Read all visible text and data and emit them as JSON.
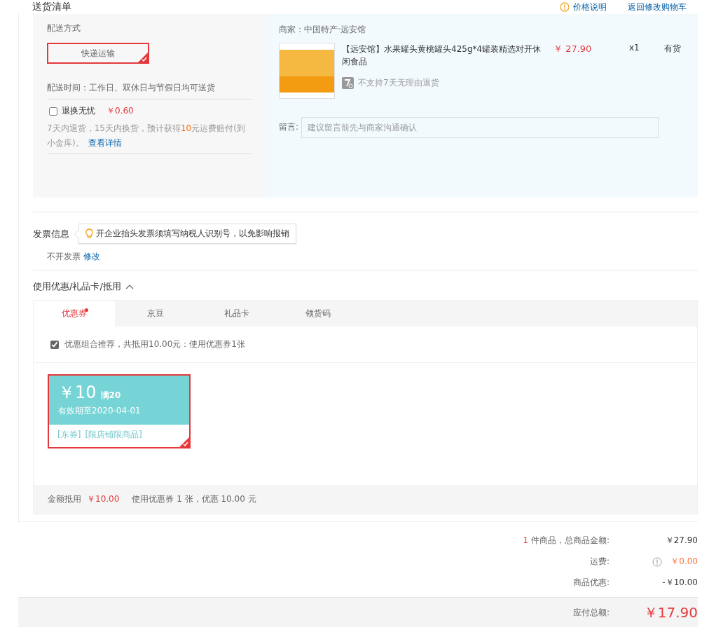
{
  "header": {
    "title": "送货清单",
    "price_note": "价格说明",
    "back_link": "返回修改购物车"
  },
  "shipping": {
    "label": "配送方式",
    "options": [
      {
        "label": "快递运输",
        "selected": true
      }
    ],
    "delivery_time": "配送时间：工作日、双休日与节假日均可送货",
    "insurance": {
      "label": "退换无忧",
      "checked": false,
      "price": "￥0.60",
      "text_before": "7天内退货，15天内换货，预计获得",
      "highlight": "10",
      "text_after": "元运费赔付(到小金库)。",
      "link": "查看详情"
    }
  },
  "seller": {
    "name": "商家：中国特产·远安馆",
    "items": [
      {
        "title": "【远安馆】水果罐头黄桃罐头425g*4罐装精选对开休闲食品",
        "price": "￥ 27.90",
        "quantity": "x1",
        "stock": "有货",
        "return_policy": "不支持7天无理由退货"
      }
    ],
    "message": {
      "label": "留言:",
      "placeholder": "建议留言前先与商家沟通确认"
    }
  },
  "invoice": {
    "title": "发票信息",
    "tip": "开企业抬头发票须填写纳税人识别号，以免影响报销",
    "value": "不开发票",
    "edit_link": "修改"
  },
  "discounts": {
    "title": "使用优惠/礼品卡/抵用",
    "expanded": true,
    "tabs": [
      {
        "label": "优惠券",
        "selected": true,
        "dot": true
      },
      {
        "label": "京豆",
        "selected": false,
        "dot": false
      },
      {
        "label": "礼品卡",
        "selected": false,
        "dot": false
      },
      {
        "label": "领货码",
        "selected": false,
        "dot": false
      }
    ],
    "recommend": {
      "checked": true,
      "label": "优惠组合推荐，共抵用10.00元：使用优惠券1张"
    },
    "coupons": [
      {
        "amount": "￥10",
        "condition": "满20",
        "validity": "有效期至2020-04-01",
        "tags": [
          "[东券]",
          "[限店铺限商品]"
        ],
        "selected": true
      }
    ],
    "summary": {
      "label": "金额抵用",
      "amount": "￥10.00",
      "detail": "使用优惠券 1 张，优惠 10.00 元"
    }
  },
  "totals": {
    "rows": [
      {
        "kind": "count",
        "count": "1",
        "label": "件商品，总商品金额:",
        "value": "￥27.90"
      },
      {
        "kind": "fee",
        "label": "运费:",
        "value": "￥0.00"
      },
      {
        "kind": "plain",
        "label": "商品优惠:",
        "value": "-￥10.00"
      }
    ],
    "payable": {
      "label": "应付总额:",
      "value": "￥17.90"
    }
  }
}
